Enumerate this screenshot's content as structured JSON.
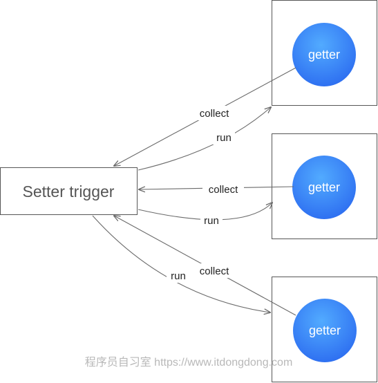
{
  "setter": {
    "label": "Setter trigger"
  },
  "getters": [
    {
      "label": "getter"
    },
    {
      "label": "getter"
    },
    {
      "label": "getter"
    }
  ],
  "edges": {
    "collect_top": "collect",
    "run_top": "run",
    "collect_middle": "collect",
    "run_middle": "run",
    "collect_bottom": "collect",
    "run_bottom": "run"
  },
  "watermark": "程序员自习室 https://www.itdongdong.com",
  "colors": {
    "getter_fill_light": "#4fa6ff",
    "getter_fill_dark": "#2d6ff0",
    "box_stroke": "#555555",
    "edge_stroke": "#6a6a6a"
  }
}
